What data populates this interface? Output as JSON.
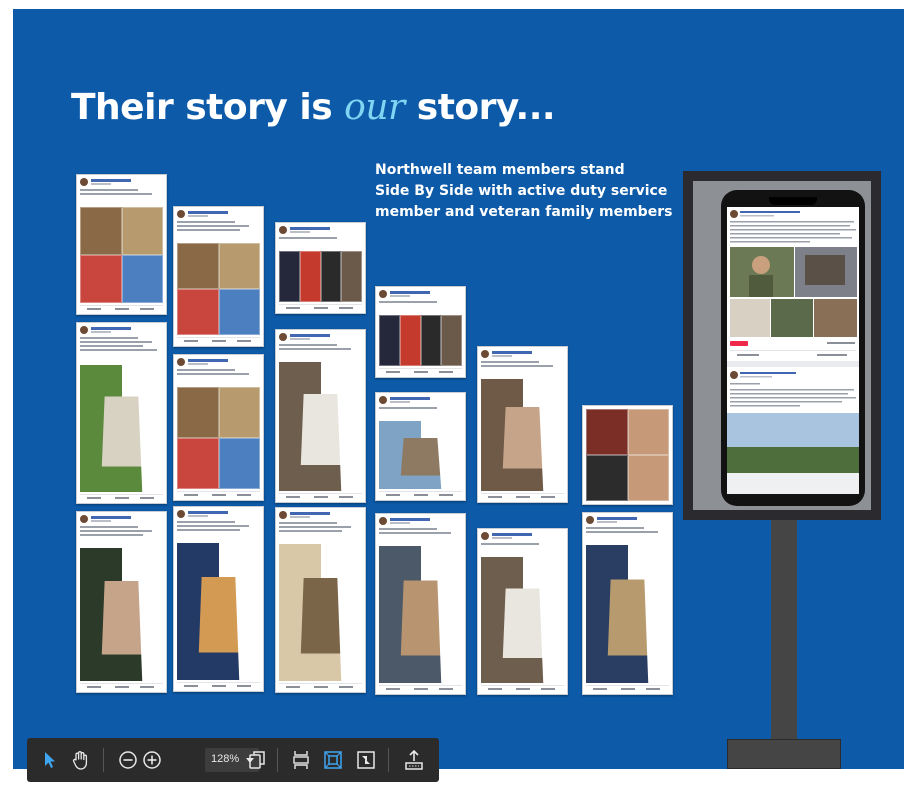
{
  "slide": {
    "title_pre": "Their story is ",
    "title_accent": "our",
    "title_post": " story...",
    "subtitle_lines": [
      "Northwell team members stand",
      "Side By Side with active duty service",
      "member and veteran family members"
    ],
    "colors": {
      "background": "#0c5aa8",
      "accent": "#7fd6f2",
      "text": "#ffffff"
    }
  },
  "collage": {
    "card_count": 16,
    "kiosk_phone_posts": 2
  },
  "toolbar": {
    "zoom_value": "128%",
    "icons": [
      "cursor-arrow-icon",
      "hand-pan-icon",
      "zoom-out-icon",
      "zoom-in-icon",
      "zoom-dropdown-chevron-icon",
      "copy-pages-icon",
      "fit-page-icon",
      "fit-width-icon",
      "fullscreen-icon",
      "share-upload-icon"
    ],
    "colors": {
      "background": "#2b2b2b",
      "active": "#3fa6f2",
      "icon": "#e8e8e8"
    }
  }
}
